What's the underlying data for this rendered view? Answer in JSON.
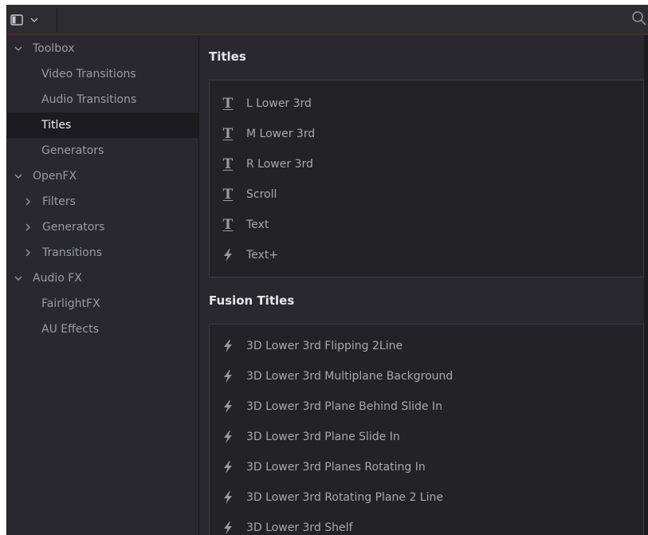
{
  "sidebar": {
    "items": [
      {
        "label": "Toolbox",
        "chevron": "down",
        "level": 0
      },
      {
        "label": "Video Transitions",
        "chevron": "none",
        "level": 1
      },
      {
        "label": "Audio Transitions",
        "chevron": "none",
        "level": 1
      },
      {
        "label": "Titles",
        "chevron": "none",
        "level": 1,
        "selected": true
      },
      {
        "label": "Generators",
        "chevron": "none",
        "level": 1
      },
      {
        "label": "OpenFX",
        "chevron": "down",
        "level": 0
      },
      {
        "label": "Filters",
        "chevron": "right",
        "level": 1
      },
      {
        "label": "Generators",
        "chevron": "right",
        "level": 1
      },
      {
        "label": "Transitions",
        "chevron": "right",
        "level": 1
      },
      {
        "label": "Audio FX",
        "chevron": "down",
        "level": 0
      },
      {
        "label": "FairlightFX",
        "chevron": "none",
        "level": 1
      },
      {
        "label": "AU Effects",
        "chevron": "none",
        "level": 1
      }
    ]
  },
  "sections": [
    {
      "title": "Titles",
      "items": [
        {
          "label": "L Lower 3rd",
          "icon": "title-text-icon"
        },
        {
          "label": "M Lower 3rd",
          "icon": "title-text-icon"
        },
        {
          "label": "R Lower 3rd",
          "icon": "title-text-icon"
        },
        {
          "label": "Scroll",
          "icon": "title-text-icon"
        },
        {
          "label": "Text",
          "icon": "title-text-icon"
        },
        {
          "label": "Text+",
          "icon": "fusion-bolt-icon"
        }
      ]
    },
    {
      "title": "Fusion Titles",
      "items": [
        {
          "label": "3D Lower 3rd Flipping 2Line",
          "icon": "fusion-bolt-icon"
        },
        {
          "label": "3D Lower 3rd Multiplane Background",
          "icon": "fusion-bolt-icon"
        },
        {
          "label": "3D Lower 3rd Plane Behind Slide In",
          "icon": "fusion-bolt-icon"
        },
        {
          "label": "3D Lower 3rd Plane Slide In",
          "icon": "fusion-bolt-icon"
        },
        {
          "label": "3D Lower 3rd Planes Rotating In",
          "icon": "fusion-bolt-icon"
        },
        {
          "label": "3D Lower 3rd Rotating Plane 2 Line",
          "icon": "fusion-bolt-icon"
        },
        {
          "label": "3D Lower 3rd Shelf",
          "icon": "fusion-bolt-icon"
        }
      ]
    }
  ],
  "colors": {
    "background": "#28282e",
    "selected_row": "#1c1c20",
    "accent_line": "#4a2e2c"
  }
}
